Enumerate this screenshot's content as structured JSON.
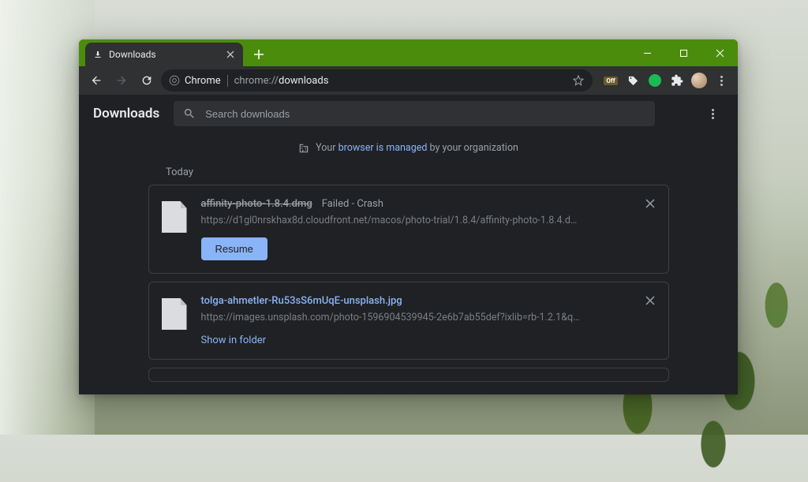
{
  "tab": {
    "title": "Downloads"
  },
  "omnibox": {
    "label": "Chrome",
    "url_prefix": "chrome://",
    "url_path": "downloads"
  },
  "page": {
    "title": "Downloads",
    "search_placeholder": "Search downloads"
  },
  "managed_notice": {
    "prefix": "Your ",
    "link": "browser is managed",
    "suffix": " by your organization"
  },
  "section_label": "Today",
  "buttons": {
    "resume": "Resume",
    "show_in_folder": "Show in folder"
  },
  "downloads": [
    {
      "filename": "affinity-photo-1.8.4.dmg",
      "status": "Failed - Crash",
      "url": "https://d1gl0nrskhax8d.cloudfront.net/macos/photo-trial/1.8.4/affinity-photo-1.8.4.d…",
      "failed": true,
      "action": "resume"
    },
    {
      "filename": "tolga-ahmetler-Ru53sS6mUqE-unsplash.jpg",
      "status": "",
      "url": "https://images.unsplash.com/photo-1596904539945-2e6b7ab55def?ixlib=rb-1.2.1&q…",
      "failed": false,
      "action": "show_in_folder"
    }
  ]
}
